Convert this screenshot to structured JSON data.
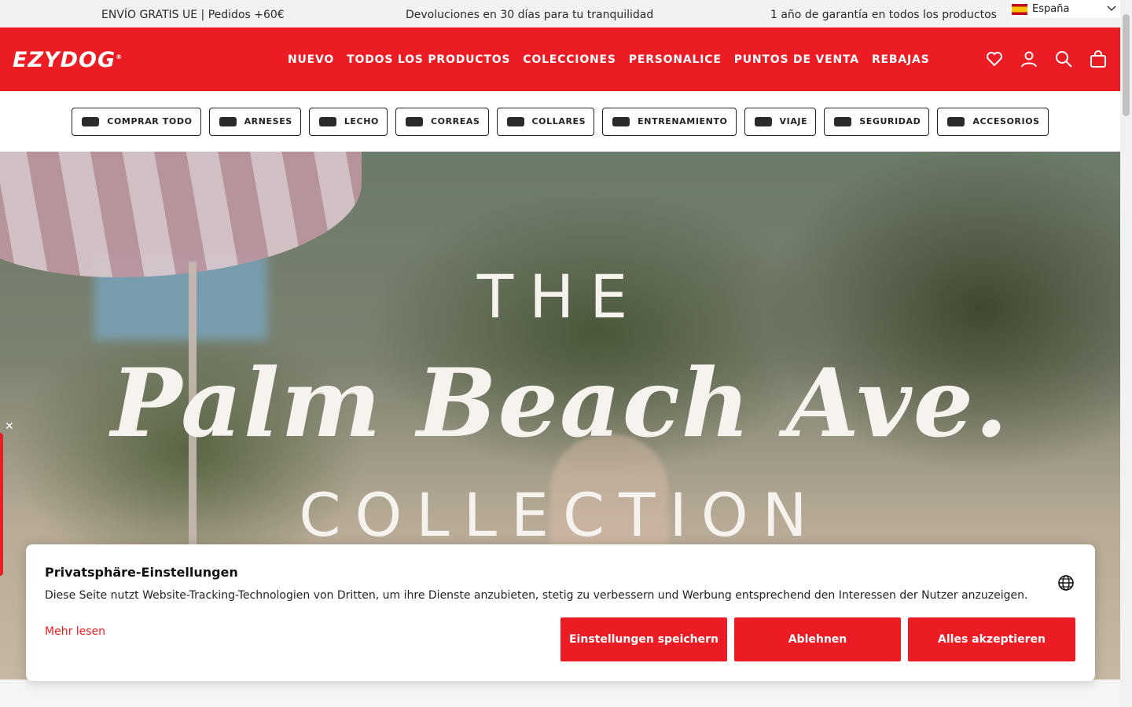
{
  "announcement": {
    "left": "ENVÍO GRATIS UE | Pedidos +60€",
    "center": "Devoluciones en 30 días para tu tranquilidad",
    "right": "1 año de garantía en todos los productos"
  },
  "language_selector": {
    "label": "España",
    "flag_icon": "spain-flag-icon"
  },
  "header": {
    "logo": "EZYDOG",
    "nav": [
      "NUEVO",
      "TODOS LOS PRODUCTOS",
      "COLECCIONES",
      "PERSONALICE",
      "PUNTOS DE VENTA",
      "REBAJAS"
    ],
    "icons": [
      "heart-icon",
      "account-icon",
      "search-icon",
      "bag-icon"
    ],
    "brand_color": "#ec1c24"
  },
  "categories": [
    "COMPRAR TODO",
    "ARNESES",
    "LECHO",
    "CORREAS",
    "COLLARES",
    "ENTRENAMIENTO",
    "VIAJE",
    "SEGURIDAD",
    "ACCESORIOS"
  ],
  "hero": {
    "line1": "THE",
    "line2": "Palm Beach Ave.",
    "line3": "COLLECTION"
  },
  "cookie_banner": {
    "title": "Privatsphäre-Einstellungen",
    "text": "Diese Seite nutzt Website-Tracking-Technologien von Dritten, um ihre Dienste anzubieten, stetig zu verbessern und Werbung entsprechend den Interessen der Nutzer anzuzeigen.",
    "more_link": "Mehr lesen",
    "save_button": "Einstellungen speichern",
    "reject_button": "Ablehnen",
    "accept_button": "Alles akzeptieren"
  }
}
